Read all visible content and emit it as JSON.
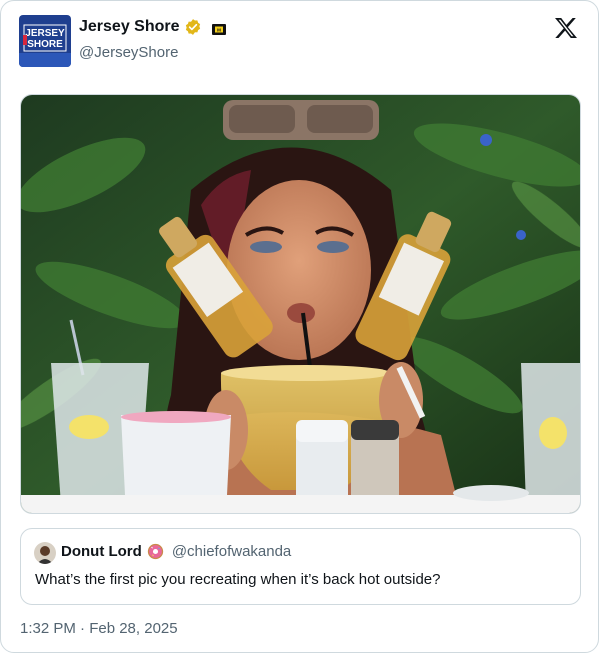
{
  "author": {
    "display_name": "Jersey Shore",
    "handle": "@JerseyShore",
    "avatar_text": "JERSEY SHORE",
    "verified": true,
    "verified_color": "#e2b719",
    "affiliate_badge_icon": "mtv-badge-icon"
  },
  "brand": {
    "logo_icon": "x-logo-icon"
  },
  "media": {
    "alt": "photo",
    "icon": "photo"
  },
  "quote": {
    "display_name": "Donut Lord",
    "emoji_icon": "donut-icon",
    "handle": "@chiefofwakanda",
    "text": "What’s the first pic you recreating when it’s back hot outside?"
  },
  "timestamp": "1:32 PM · Feb 28, 2025",
  "colors": {
    "text_primary": "#0f1419",
    "text_secondary": "#536471",
    "border": "#cfd9de"
  }
}
